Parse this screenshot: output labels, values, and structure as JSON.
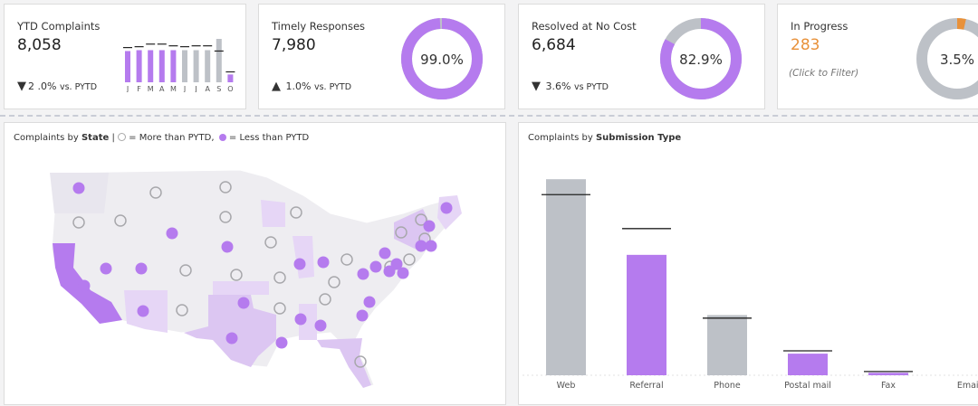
{
  "colors": {
    "purple": "#b57bee",
    "gray": "#bdc1c7",
    "orange": "#e8913a",
    "light_purple": "#dcc6f2"
  },
  "kpi": {
    "ytd": {
      "title": "YTD Complaints",
      "value": "8,058",
      "arrow": "▼",
      "change": "2 .0%",
      "suffix": "vs. PYTD",
      "months": [
        "J",
        "F",
        "M",
        "A",
        "M",
        "J",
        "J",
        "A",
        "S",
        "O"
      ],
      "bar_values": [
        0.72,
        0.74,
        0.74,
        0.74,
        0.74,
        0.74,
        0.74,
        0.74,
        1.0,
        0.18
      ],
      "prior_values": [
        0.8,
        0.82,
        0.88,
        0.88,
        0.84,
        0.82,
        0.84,
        0.84,
        0.72,
        0.24
      ],
      "bar_colors": [
        "purple",
        "purple",
        "purple",
        "purple",
        "purple",
        "gray",
        "gray",
        "gray",
        "gray",
        "purple"
      ]
    },
    "timely": {
      "title": "Timely Responses",
      "value": "7,980",
      "arrow": "▲",
      "change": "1.0%",
      "suffix": "vs. PYTD",
      "pct": "99.0%",
      "fraction": 0.99
    },
    "resolved": {
      "title": "Resolved at No Cost",
      "value": "6,684",
      "arrow": "▼",
      "change": "3.6%",
      "suffix": "vs PYTD",
      "pct": "82.9%",
      "fraction": 0.829
    },
    "progress": {
      "title": "In Progress",
      "value": "283",
      "hint": "(Click to Filter)",
      "pct": "3.5%",
      "fraction": 0.035
    }
  },
  "map_panel": {
    "prefix": "Complaints by ",
    "bold": "State",
    "sep": " | ",
    "legend_more": " = More than PYTD,",
    "legend_less": " = Less than PYTD"
  },
  "submission_panel": {
    "prefix": "Complaints by ",
    "bold": "Submission Type"
  },
  "chart_data": {
    "type": "bar",
    "title": "Complaints by Submission Type",
    "categories": [
      "Web",
      "Referral",
      "Phone",
      "Postal mail",
      "Fax",
      "Email"
    ],
    "values": [
      6350,
      3900,
      1950,
      700,
      80,
      0
    ],
    "prior": [
      5850,
      4750,
      1850,
      790,
      120,
      0
    ],
    "bar_colors": [
      "gray",
      "purple",
      "gray",
      "purple",
      "purple",
      "gray"
    ],
    "ylim": [
      0,
      7000
    ]
  }
}
